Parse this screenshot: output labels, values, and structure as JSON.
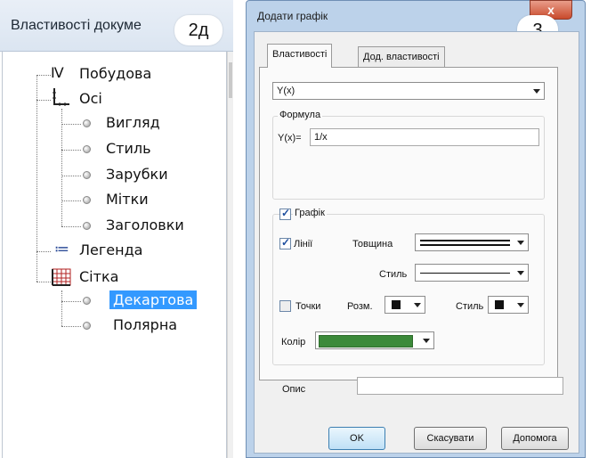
{
  "left_panel": {
    "title": "Властивості докуме",
    "badge": "2д",
    "tree": {
      "construction": {
        "icon": "IV",
        "label": "Побудова"
      },
      "axes": {
        "label": "Осі",
        "children": [
          "Вигляд",
          "Стиль",
          "Зарубки",
          "Мітки",
          "Заголовки"
        ]
      },
      "legend": {
        "icon": "≔",
        "label": "Легенда"
      },
      "grid": {
        "label": "Сітка",
        "children": [
          "Декартова",
          "Полярна"
        ],
        "selected": "Декартова"
      }
    }
  },
  "dialog": {
    "title": "Додати графік",
    "close_label": "x",
    "badge": "3",
    "tabs": [
      {
        "label": "Властивості",
        "active": true
      },
      {
        "label": "Дод. властивості",
        "active": false
      }
    ],
    "function_select": "Y(x)",
    "formula": {
      "group_label": "Формула",
      "prefix": "Y(x)=",
      "value": "1/x"
    },
    "graph": {
      "label": "Графік",
      "checked": true,
      "lines": {
        "label": "Лінії",
        "checked": true,
        "thickness_label": "Товщина",
        "style_label": "Стиль"
      },
      "points": {
        "label": "Точки",
        "checked": false,
        "size_label": "Розм.",
        "style_label": "Стиль"
      },
      "color_label": "Колір",
      "color": "#3c8a3a"
    },
    "description": {
      "label": "Опис",
      "value": ""
    },
    "buttons": {
      "ok": "OK",
      "cancel": "Скасувати",
      "help": "Допомога"
    }
  },
  "colors": {
    "selection": "#3399ff",
    "dialog_frame": "#bcd2ea",
    "close_button": "#c94a2c"
  }
}
